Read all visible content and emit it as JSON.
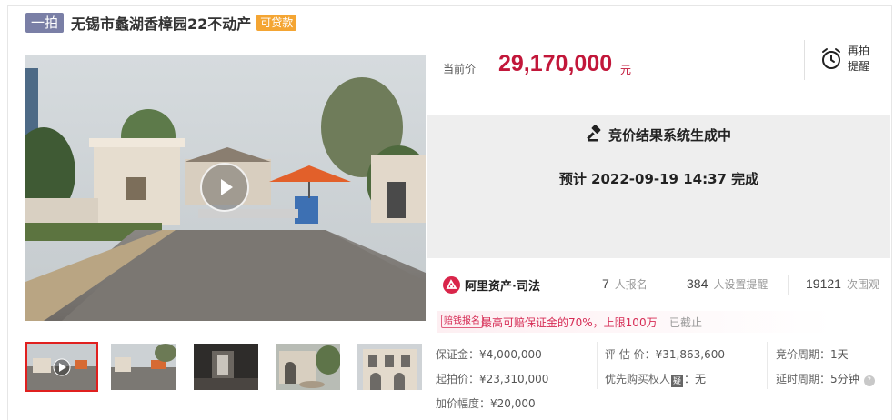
{
  "header": {
    "round_badge": "一拍",
    "title": "无锡市蠡湖香樟园22不动产",
    "loan_badge": "可贷款"
  },
  "price": {
    "label": "当前价",
    "value": "29,170,000",
    "unit": "元"
  },
  "remind": {
    "line1": "再拍",
    "line2": "提醒"
  },
  "status": {
    "main": "竞价结果系统生成中",
    "sub": "预计 2022-09-19 14:37 完成"
  },
  "platform": {
    "name": "阿里资产·司法"
  },
  "stats": [
    {
      "num": "7",
      "label": "人报名"
    },
    {
      "num": "384",
      "label": "人设置提醒"
    },
    {
      "num": "19121",
      "label": "次围观"
    }
  ],
  "promo": {
    "tag": "赔钱报名",
    "text": "最高可赔保证金的70%，上限100万",
    "status": "已截止"
  },
  "info": {
    "deposit_label": "保证金：",
    "deposit_value": "¥4,000,000",
    "appraisal_label": "评 估 价：",
    "appraisal_value": "¥31,863,600",
    "cycle_label": "竞价周期：",
    "cycle_value": "1天",
    "start_label": "起拍价：",
    "start_value": "¥23,310,000",
    "priority_label": "优先购买权人",
    "priority_tag": "疑",
    "priority_value": "：无",
    "delay_label": "延时周期：",
    "delay_value": "5分钟",
    "increment_label": "加价幅度：",
    "increment_value": "¥20,000"
  },
  "icons": {
    "play": "play-icon",
    "alarm": "alarm-clock-icon",
    "gavel": "gavel-icon",
    "logo": "ali-auction-logo-icon",
    "help": "question-icon"
  },
  "colors": {
    "price": "#c2173a",
    "round_badge": "#7a7fa6",
    "loan_badge": "#f4a533",
    "promo": "#d62b54",
    "status_bg": "#eeeeee"
  }
}
